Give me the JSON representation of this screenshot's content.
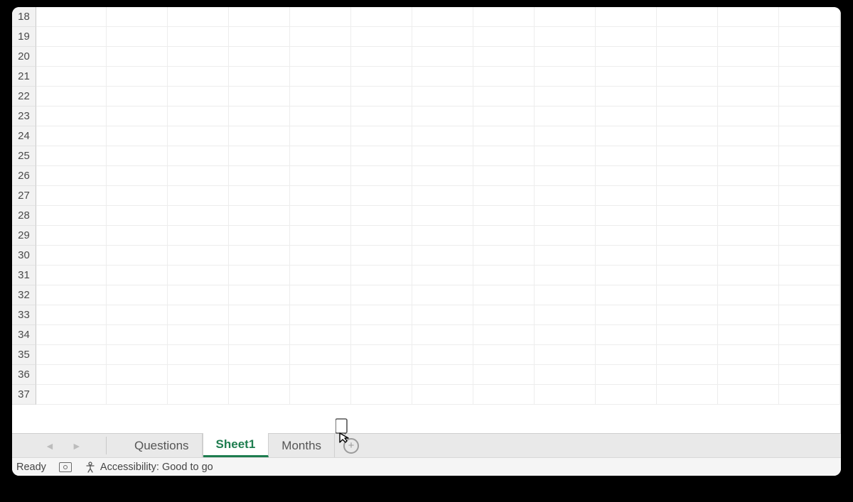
{
  "rows": [
    18,
    19,
    20,
    21,
    22,
    23,
    24,
    25,
    26,
    27,
    28,
    29,
    30,
    31,
    32,
    33,
    34,
    35,
    36,
    37
  ],
  "tabs": {
    "items": [
      {
        "label": "Questions",
        "active": false
      },
      {
        "label": "Sheet1",
        "active": true
      },
      {
        "label": "Months",
        "active": false
      }
    ]
  },
  "status": {
    "ready": "Ready",
    "accessibility": "Accessibility: Good to go"
  }
}
